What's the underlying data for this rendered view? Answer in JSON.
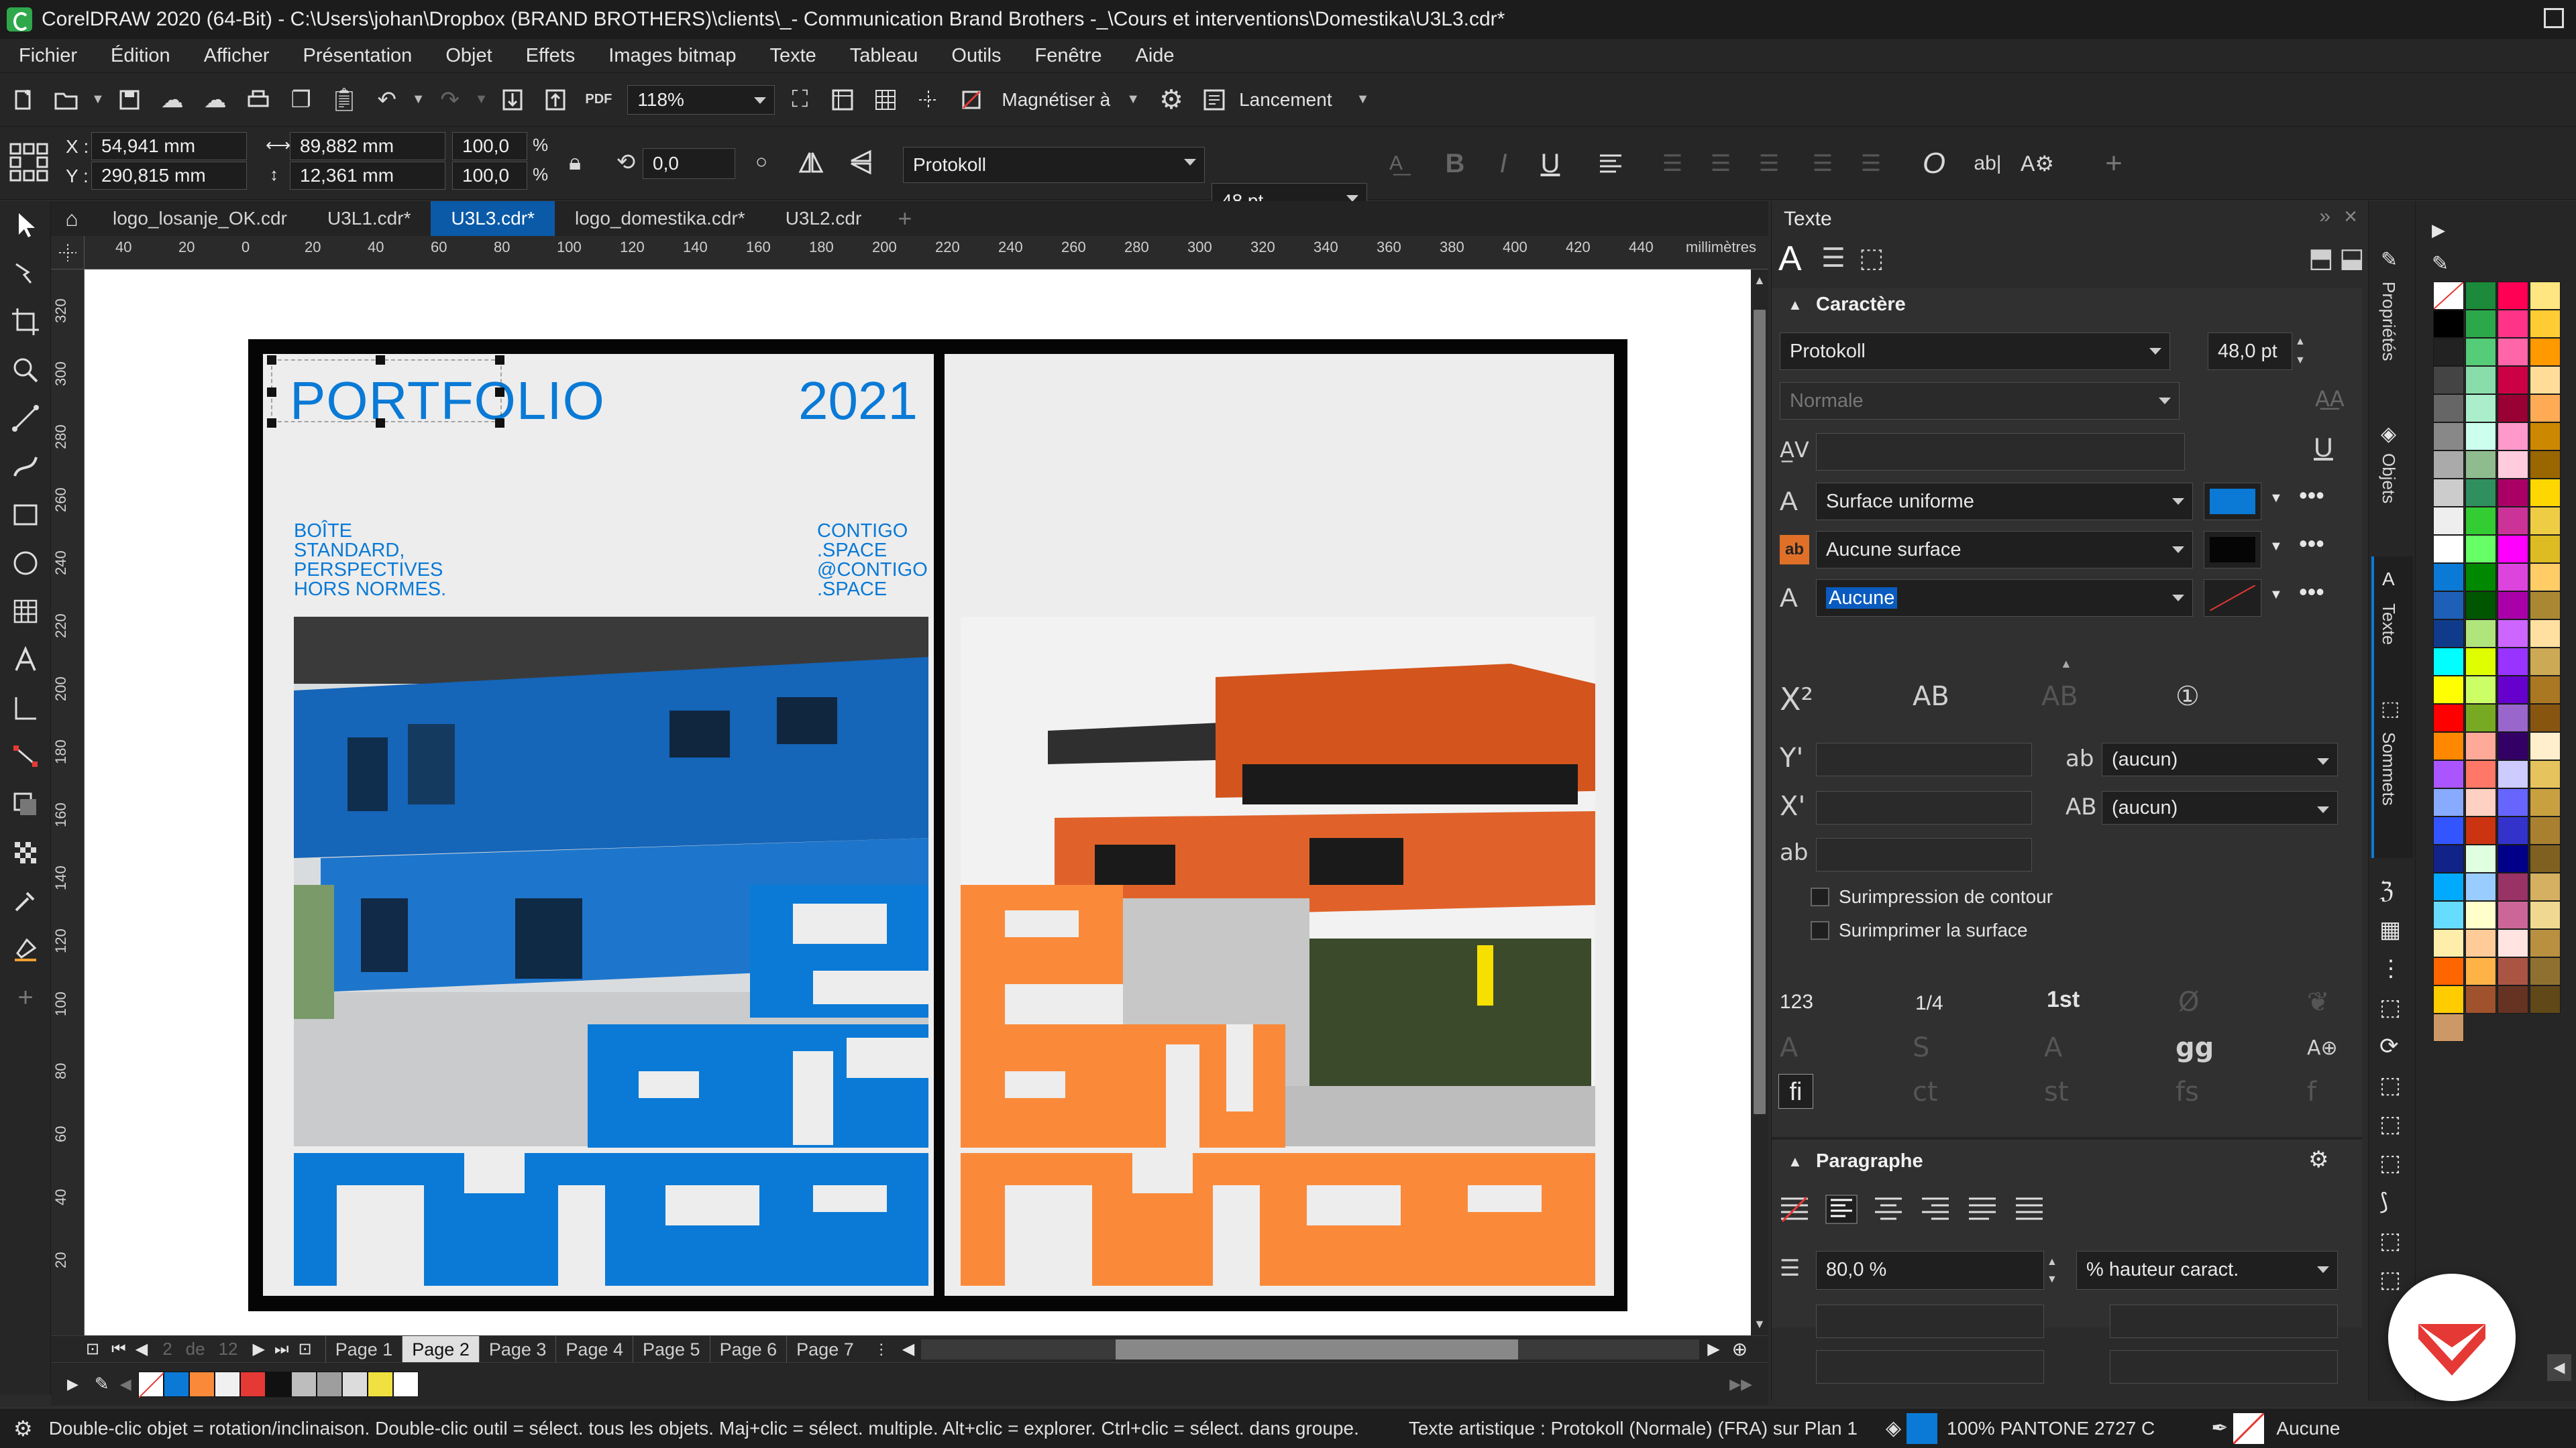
{
  "window": {
    "title": "CorelDRAW 2020 (64-Bit) - C:\\Users\\johan\\Dropbox (BRAND BROTHERS)\\clients\\_- Communication Brand Brothers -_\\Cours et interventions\\Domestika\\U3L3.cdr*"
  },
  "menu": [
    "Fichier",
    "Édition",
    "Afficher",
    "Présentation",
    "Objet",
    "Effets",
    "Images bitmap",
    "Texte",
    "Tableau",
    "Outils",
    "Fenêtre",
    "Aide"
  ],
  "toolbar": {
    "pdf_label": "PDF",
    "zoom": "118%",
    "snap_label": "Magnétiser à",
    "launch_label": "Lancement"
  },
  "propbar": {
    "x_label": "X :",
    "y_label": "Y :",
    "x": "54,941 mm",
    "y": "290,815 mm",
    "w": "89,882 mm",
    "h": "12,361 mm",
    "sx": "100,0",
    "sy": "100,0",
    "pct": "%",
    "rotation": "0,0",
    "font": "Protokoll",
    "size": "48 pt",
    "ab_label": "ab|"
  },
  "tabs": [
    {
      "label": "logo_losanje_OK.cdr",
      "active": false
    },
    {
      "label": "U3L1.cdr*",
      "active": false
    },
    {
      "label": "U3L3.cdr*",
      "active": true
    },
    {
      "label": "logo_domestika.cdr*",
      "active": false
    },
    {
      "label": "U3L2.cdr",
      "active": false
    }
  ],
  "ruler": {
    "unit": "millimètres",
    "h_ticks": [
      "40",
      "20",
      "0",
      "20",
      "40",
      "60",
      "80",
      "100",
      "120",
      "140",
      "160",
      "180",
      "200",
      "220",
      "240",
      "260",
      "280",
      "300",
      "320",
      "340",
      "360",
      "380",
      "400",
      "420",
      "440"
    ],
    "v_ticks": [
      "320",
      "300",
      "280",
      "260",
      "240",
      "220",
      "200",
      "180",
      "160",
      "140",
      "120",
      "100",
      "80",
      "60",
      "40",
      "20"
    ]
  },
  "poster_left": {
    "title": "PORTFOLIO",
    "year": "2021",
    "tagline": [
      "BOÎTE",
      "STANDARD,",
      "PERSPECTIVES",
      "HORS NORMES."
    ],
    "contact": [
      "CONTIGO",
      ".SPACE",
      "@CONTIGO",
      ".SPACE"
    ],
    "accent": "#0a7ad6"
  },
  "poster_right": {
    "accent": "#fa8a3a"
  },
  "pages": {
    "current": "2",
    "of": "de",
    "total": "12",
    "tabs": [
      "Page 1",
      "Page 2",
      "Page 3",
      "Page 4",
      "Page 5",
      "Page 6",
      "Page 7"
    ]
  },
  "docker": {
    "title": "Texte",
    "section_char": "Caractère",
    "font": "Protokoll",
    "font_size": "48,0 pt",
    "style": "Normale",
    "fill_type": "Surface uniforme",
    "fill_color": "#0a7ad6",
    "bg_fill": "Aucune surface",
    "outline": "Aucune",
    "superscript_dd": "(aucun)",
    "caps_dd": "(aucun)",
    "overprint_outline": "Surimpression de contour",
    "overprint_fill": "Surimprimer la surface",
    "fraction": "1/4",
    "ordinal": "1st",
    "num": "123",
    "section_para": "Paragraphe",
    "line_spacing": "80,0 %",
    "spacing_unit": "% hauteur caract."
  },
  "sidetabs": [
    "Propriétés",
    "Objets",
    "Texte",
    "Sommets"
  ],
  "status": {
    "hint": "Double-clic objet = rotation/inclinaison. Double-clic outil = sélect. tous les objets. Maj+clic = sélect. multiple. Alt+clic = explorer. Ctrl+clic = sélect. dans groupe.",
    "object_info": "Texte artistique : Protokoll (Normale) (FRA) sur Plan 1",
    "fill_info": "100% PANTONE 2727 C",
    "outline_info": "Aucune"
  },
  "doc_palette": [
    "#ffffff",
    "#0a7ad6",
    "#fa8a3a",
    "#f0f0f0",
    "#e53935",
    "#111111",
    "#bdbdbd",
    "#9e9e9e",
    "#dcdcdc",
    "#f0e040",
    "#ffffff"
  ]
}
